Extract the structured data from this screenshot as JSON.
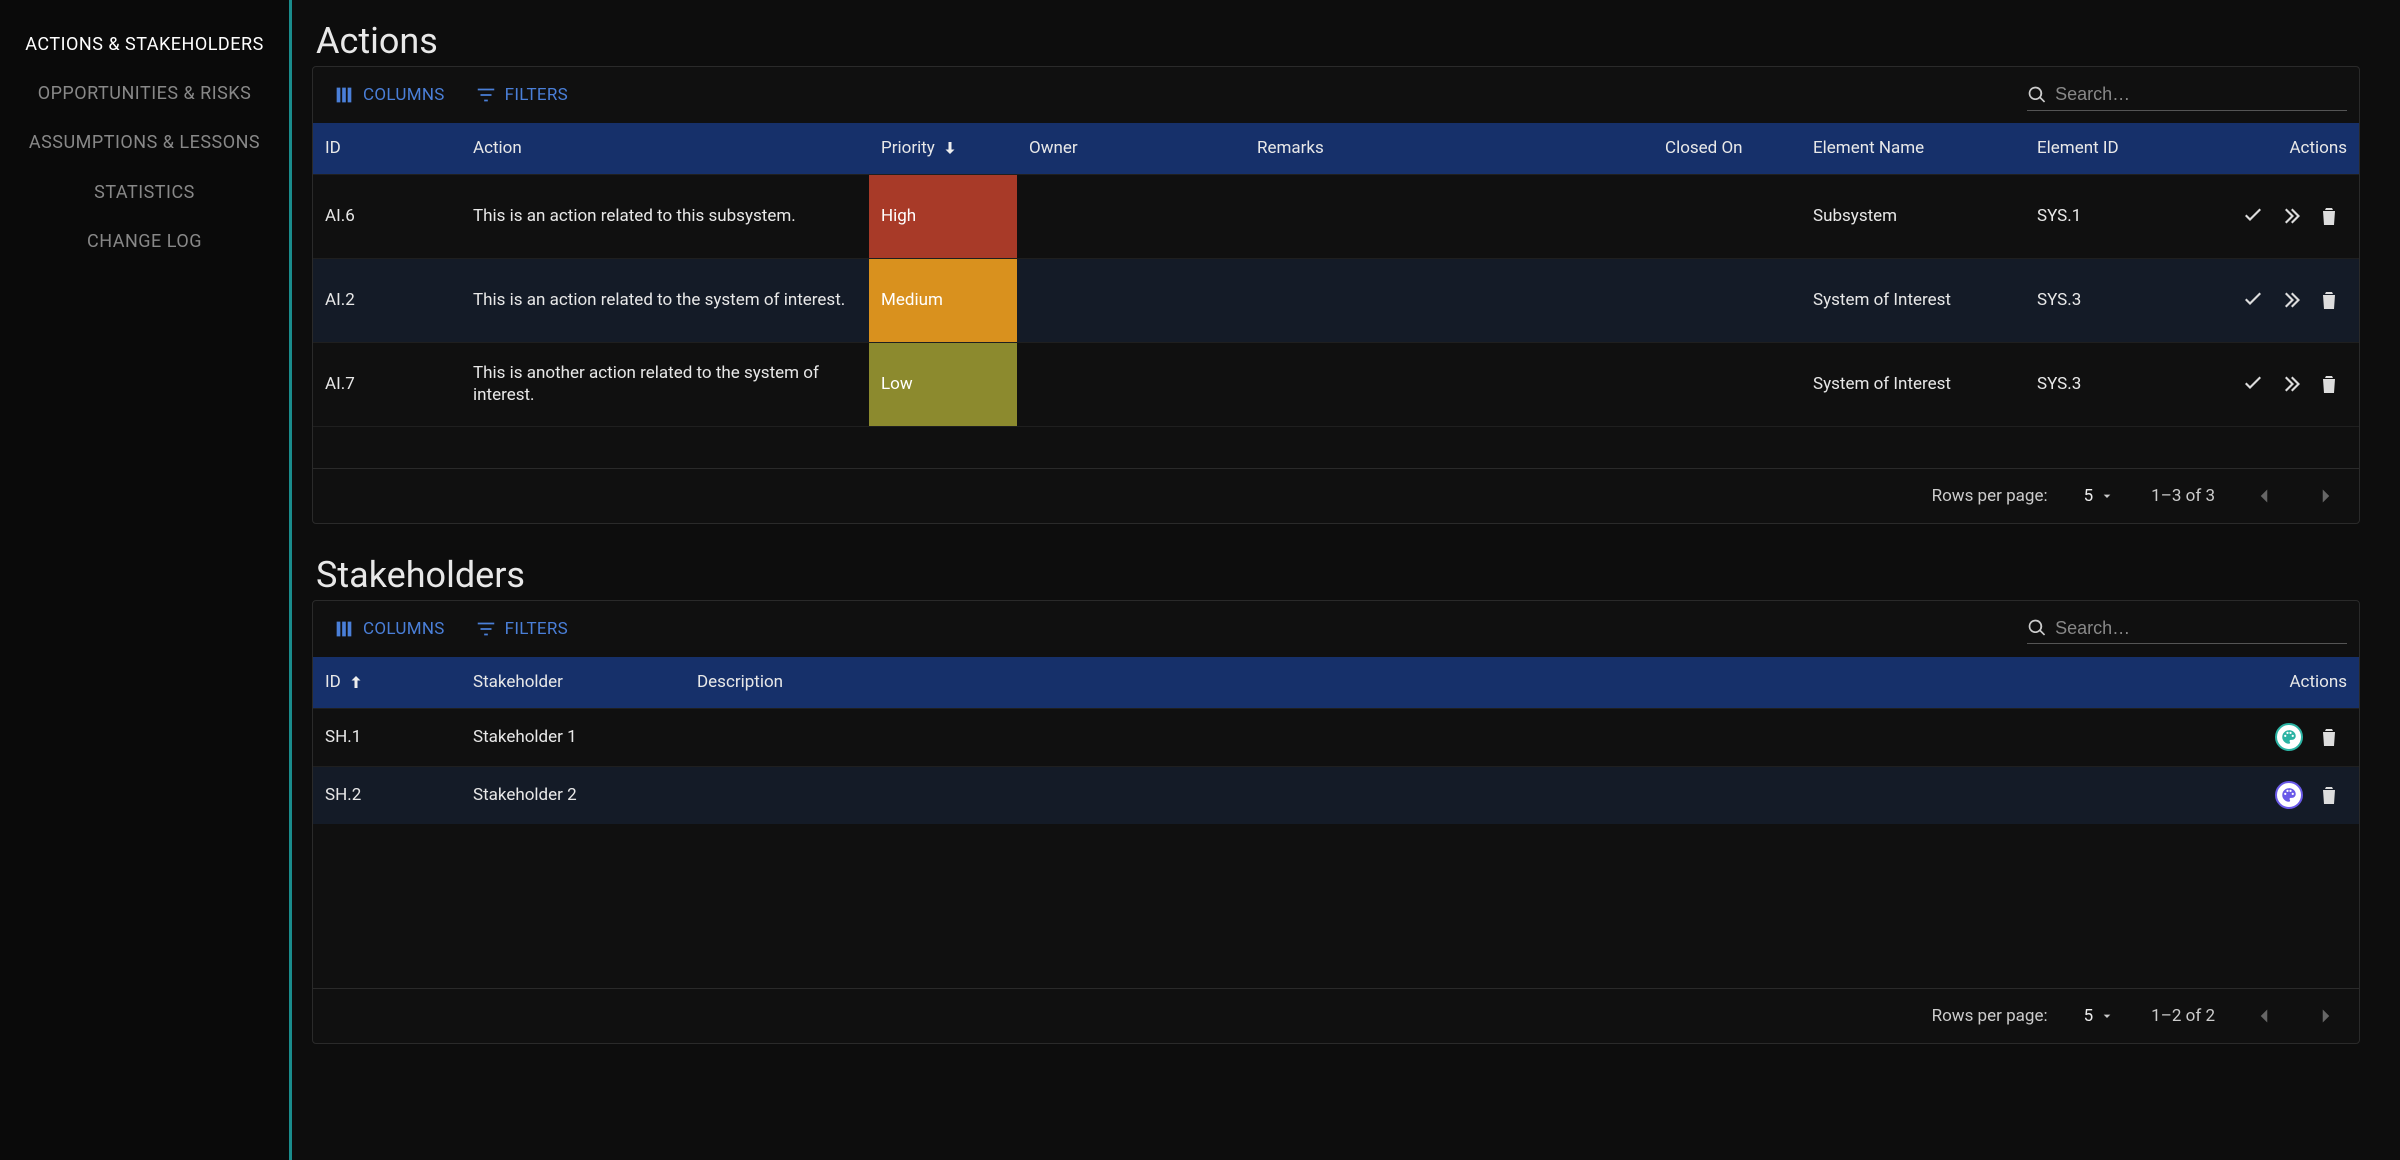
{
  "sidebar": {
    "items": [
      {
        "label": "ACTIONS & STAKEHOLDERS",
        "active": true
      },
      {
        "label": "OPPORTUNITIES & RISKS"
      },
      {
        "label": "ASSUMPTIONS & LESSONS"
      },
      {
        "label": "STATISTICS"
      },
      {
        "label": "CHANGE LOG"
      }
    ]
  },
  "sections": {
    "actions": {
      "title": "Actions",
      "toolbar": {
        "columns": "COLUMNS",
        "filters": "FILTERS"
      },
      "search_placeholder": "Search…",
      "columns": {
        "id": "ID",
        "action": "Action",
        "priority": "Priority",
        "owner": "Owner",
        "remarks": "Remarks",
        "closed_on": "Closed On",
        "element_name": "Element Name",
        "element_id": "Element ID",
        "actions": "Actions"
      },
      "rows": [
        {
          "id": "AI.6",
          "action": "This is an action related to this subsystem.",
          "priority": "High",
          "priority_class": "pri-high",
          "owner": "",
          "remarks": "",
          "closed_on": "",
          "element_name": "Subsystem",
          "element_id": "SYS.1"
        },
        {
          "id": "AI.2",
          "action": "This is an action related to the system of interest.",
          "priority": "Medium",
          "priority_class": "pri-med",
          "owner": "",
          "remarks": "",
          "closed_on": "",
          "element_name": "System of Interest",
          "element_id": "SYS.3"
        },
        {
          "id": "AI.7",
          "action": "This is another action related to the system of interest.",
          "priority": "Low",
          "priority_class": "pri-low",
          "owner": "",
          "remarks": "",
          "closed_on": "",
          "element_name": "System of Interest",
          "element_id": "SYS.3"
        }
      ],
      "footer": {
        "rows_per_page_label": "Rows per page:",
        "rows_per_page": "5",
        "range": "1–3 of 3"
      }
    },
    "stakeholders": {
      "title": "Stakeholders",
      "toolbar": {
        "columns": "COLUMNS",
        "filters": "FILTERS"
      },
      "search_placeholder": "Search…",
      "columns": {
        "id": "ID",
        "stakeholder": "Stakeholder",
        "description": "Description",
        "actions": "Actions"
      },
      "rows": [
        {
          "id": "SH.1",
          "stakeholder": "Stakeholder 1",
          "description": "",
          "palette": "teal"
        },
        {
          "id": "SH.2",
          "stakeholder": "Stakeholder 2",
          "description": "",
          "palette": "purple"
        }
      ],
      "footer": {
        "rows_per_page_label": "Rows per page:",
        "rows_per_page": "5",
        "range": "1–2 of 2"
      }
    }
  }
}
